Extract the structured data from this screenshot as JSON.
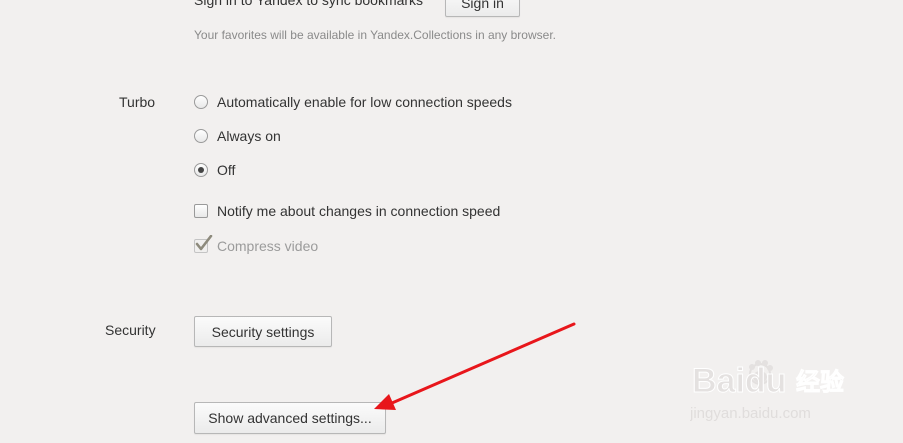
{
  "sync": {
    "text": "Sign in to Yandex to sync bookmarks",
    "signin_label": "Sign in",
    "hint": "Your favorites will be available in Yandex.Collections in any browser."
  },
  "turbo": {
    "label": "Turbo",
    "options": [
      {
        "label": "Automatically enable for low connection speeds",
        "checked": false
      },
      {
        "label": "Always on",
        "checked": false
      },
      {
        "label": "Off",
        "checked": true
      }
    ],
    "notify_label": "Notify me about changes in connection speed",
    "notify_checked": false,
    "compress_label": "Compress video",
    "compress_checked": true,
    "compress_disabled": true
  },
  "security": {
    "label": "Security",
    "button_label": "Security settings"
  },
  "advanced": {
    "button_label": "Show advanced settings..."
  },
  "annotation": {
    "arrow_color": "#e8161b"
  },
  "watermark": {
    "brand": "Baidu",
    "cn": "经验",
    "url": "jingyan.baidu.com"
  }
}
